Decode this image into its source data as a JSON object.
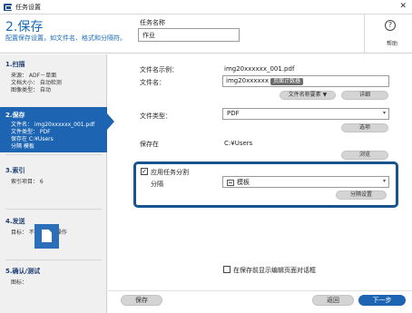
{
  "window": {
    "title": "任务设置",
    "close_glyph": "✕"
  },
  "header": {
    "step_title": "2.保存",
    "step_desc": "配置保存设置，如文件名、格式和分隔符。",
    "taskname_label": "任务名称",
    "taskname_value": "作业",
    "help_glyph": "?",
    "help_label": "帮助"
  },
  "sidebar": {
    "scan": {
      "title": "1.扫描",
      "lines": [
        "来源： ADF－单面",
        "文档大小： 自动检测",
        "图像类型： 自动"
      ]
    },
    "save": {
      "title": "2.保存",
      "lines": [
        "文件名： img20xxxxxx_001.pdf",
        "文件类型： PDF",
        "保存在 C:¥Users",
        "分隔 模板"
      ]
    },
    "index": {
      "title": "3.索引",
      "lines": [
        "索引项目： 6"
      ]
    },
    "send": {
      "title": "4.发送",
      "lines": [
        "目标： 不进行任何操作"
      ]
    },
    "confirm": {
      "title": "5.确认/测试",
      "lines": [
        "图标："
      ]
    }
  },
  "main": {
    "filename_example_label": "文件名示例：",
    "filename_example_value": "img20xxxxxx_001.pdf",
    "filename_label": "文件名：",
    "filename_value": "img20xxxxxx",
    "counter_chip": "页面计数器",
    "filename_element_button": "文件名称要素 ▼",
    "detail_button": "详细",
    "filetype_label": "文件类型：",
    "filetype_value": "PDF",
    "options_button": "选项",
    "savein_label": "保存在",
    "savein_value": "C:¥Users",
    "browse_button": "浏览",
    "apply_split_label": "应用任务分割",
    "apply_split_checked": "✓",
    "split_label": "分隔",
    "split_value": "模板",
    "split_settings_button": "分隔设置",
    "show_edit_dialog_label": "在保存前显示编辑页面对话框"
  },
  "footer": {
    "save": "保存",
    "back": "返回",
    "next": "下一步"
  },
  "colors": {
    "accent": "#1d65b3",
    "highlight_border": "#17538f",
    "title_blue": "#1a6bb8"
  }
}
